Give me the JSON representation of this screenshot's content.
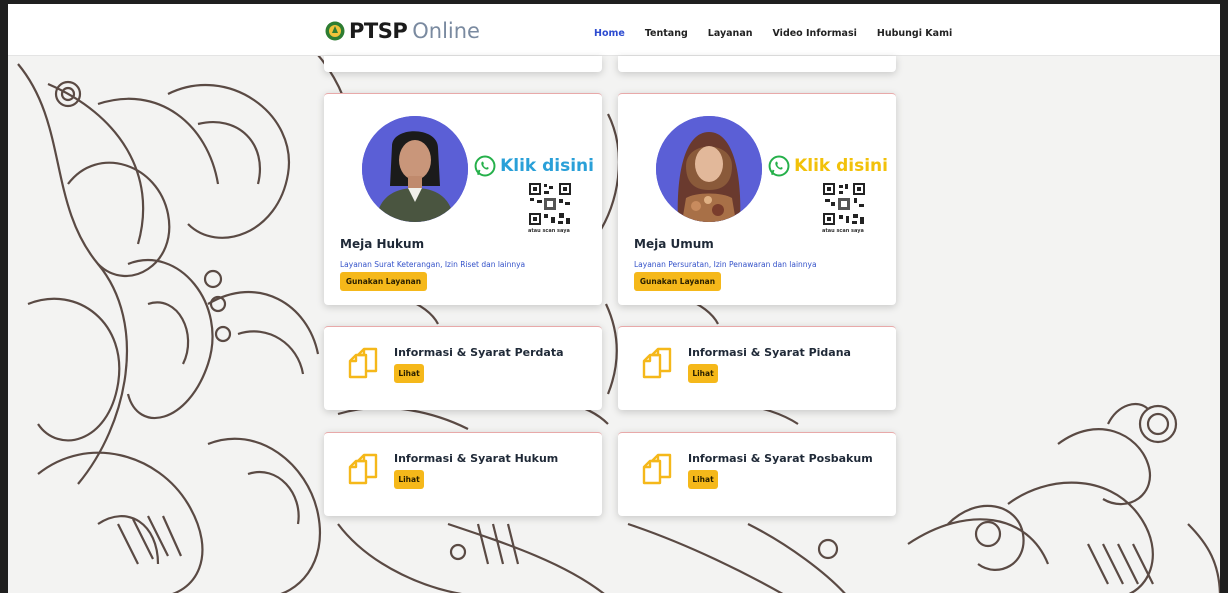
{
  "brand": {
    "main": "PTSP",
    "sub": "Online"
  },
  "nav": [
    {
      "label": "Home",
      "active": true
    },
    {
      "label": "Tentang"
    },
    {
      "label": "Layanan"
    },
    {
      "label": "Video Informasi"
    },
    {
      "label": "Hubungi Kami"
    }
  ],
  "colors": {
    "accent": "#f5b81a",
    "link": "#3452c9",
    "active_nav": "#2d4bd0",
    "whatsapp": "#25b04a",
    "klik_blue": "#2aa0d8",
    "klik_yellow": "#f2c10a"
  },
  "services": [
    {
      "title": "Meja Hukum",
      "description": "Layanan Surat Keterangan, Izin Riset dan lainnya",
      "button": "Gunakan Layanan",
      "whatsapp_text": "Klik disini",
      "scan_text": "atau scan saya"
    },
    {
      "title": "Meja Umum",
      "description": "Layanan Persuratan, Izin Penawaran dan lainnya",
      "button": "Gunakan Layanan",
      "whatsapp_text": "Klik disini",
      "scan_text": "atau scan saya"
    }
  ],
  "info": [
    {
      "title": "Informasi & Syarat Perdata",
      "button": "Lihat"
    },
    {
      "title": "Informasi & Syarat Pidana",
      "button": "Lihat"
    },
    {
      "title": "Informasi & Syarat Hukum",
      "button": "Lihat"
    },
    {
      "title": "Informasi & Syarat Posbakum",
      "button": "Lihat"
    }
  ],
  "icons": {
    "logo": "court-emblem-icon",
    "whatsapp": "whatsapp-icon",
    "qr": "qr-code-icon",
    "info": "documents-icon"
  }
}
